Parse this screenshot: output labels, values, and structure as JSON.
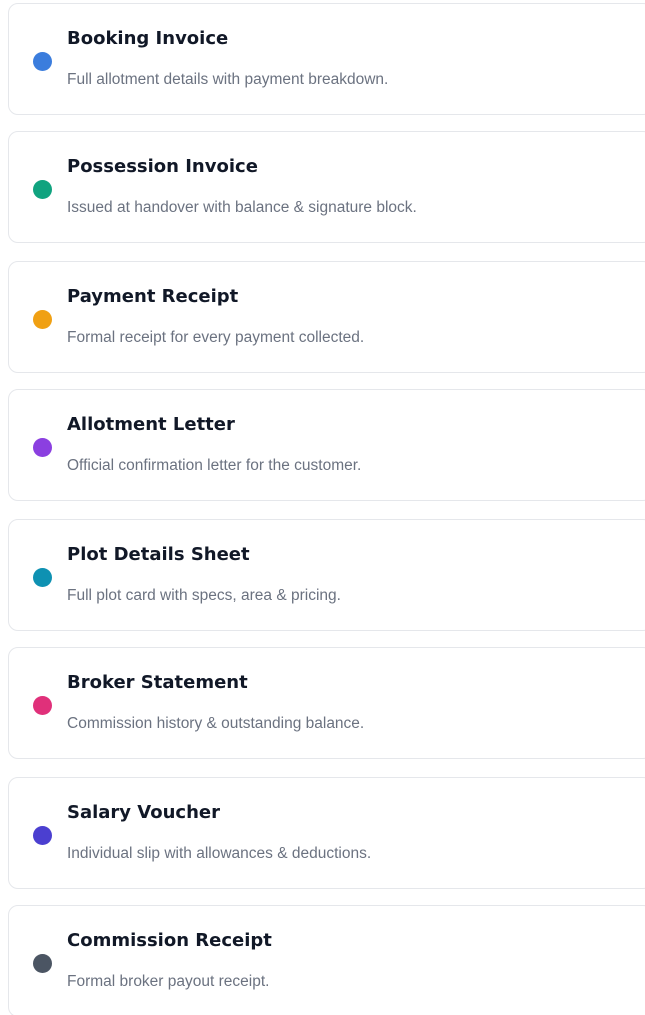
{
  "documents": [
    {
      "title": "Booking Invoice",
      "description": "Full allotment details with payment breakdown.",
      "dot_color": "#3b7ddd",
      "icon": "dot-icon"
    },
    {
      "title": "Possession Invoice",
      "description": "Issued at handover with balance & signature block.",
      "dot_color": "#10a37f",
      "icon": "dot-icon"
    },
    {
      "title": "Payment Receipt",
      "description": "Formal receipt for every payment collected.",
      "dot_color": "#f0a013",
      "icon": "dot-icon"
    },
    {
      "title": "Allotment Letter",
      "description": "Official confirmation letter for the customer.",
      "dot_color": "#8b3fe0",
      "icon": "dot-icon"
    },
    {
      "title": "Plot Details Sheet",
      "description": "Full plot card with specs, area & pricing.",
      "dot_color": "#0e91b2",
      "icon": "dot-icon"
    },
    {
      "title": "Broker Statement",
      "description": "Commission history & outstanding balance.",
      "dot_color": "#e0307a",
      "icon": "dot-icon"
    },
    {
      "title": "Salary Voucher",
      "description": "Individual slip with allowances & deductions.",
      "dot_color": "#4b3fd0",
      "icon": "dot-icon"
    },
    {
      "title": "Commission Receipt",
      "description": "Formal broker payout receipt.",
      "dot_color": "#4b5563",
      "icon": "dot-icon"
    }
  ]
}
